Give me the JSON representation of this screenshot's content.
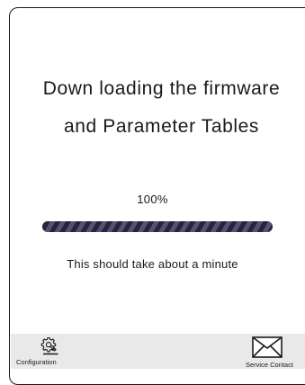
{
  "screen": {
    "title_line1": "Down loading the firmware",
    "title_line2": "and Parameter Tables"
  },
  "progress": {
    "percent_label": "100%",
    "value": 1.0,
    "track_color": "#2a2a3e",
    "fill_color_dark": "#24243a",
    "fill_color_light": "#5a4e74"
  },
  "hint": {
    "text": "This should take about a minute"
  },
  "bottom_nav": {
    "configuration": {
      "label": "Configuration",
      "icon": "gear-wrench-icon"
    },
    "service_contact": {
      "label": "Service Contact",
      "icon": "envelope-icon"
    }
  },
  "colors": {
    "border": "#1a1a1a",
    "bottom_bar_bg": "#e9e9e9",
    "text": "#1a1a1a"
  }
}
